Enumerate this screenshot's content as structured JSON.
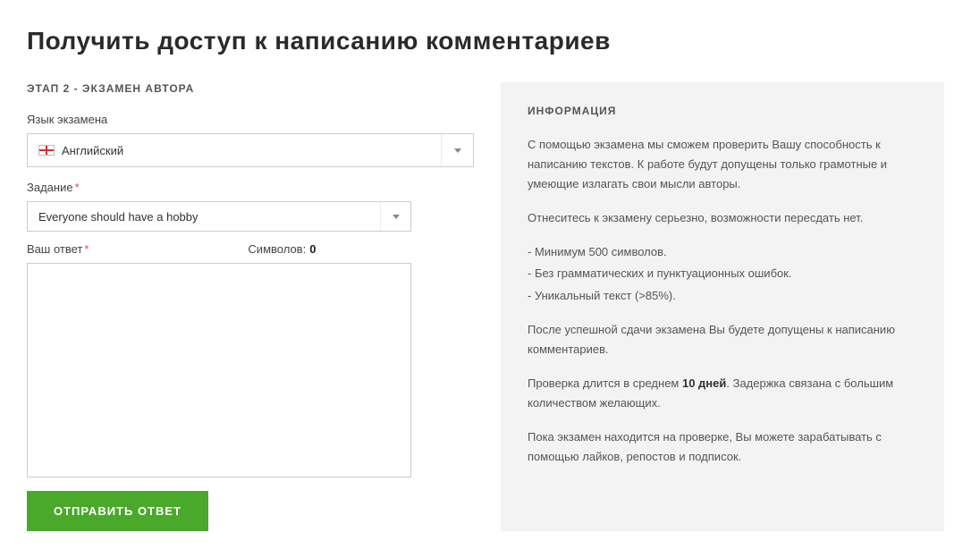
{
  "page_title": "Получить доступ к написанию комментариев",
  "left": {
    "step_label": "ЭТАП 2 - ЭКЗАМЕН АВТОРА",
    "lang_label": "Язык экзамена",
    "lang_value": "Английский",
    "task_label": "Задание",
    "task_value": "Everyone should have a hobby",
    "answer_label": "Ваш ответ",
    "symbols_label": "Символов:",
    "symbols_count": "0",
    "submit_label": "ОТПРАВИТЬ ОТВЕТ"
  },
  "info": {
    "title": "ИНФОРМАЦИЯ",
    "p1": "С помощью экзамена мы сможем проверить Вашу способность к написанию текстов. К работе будут допущены только грамотные и умеющие излагать свои мысли авторы.",
    "p2": "Отнеситесь к экзамену серьезно, возможности пересдать нет.",
    "rule1": "- Минимум 500 символов.",
    "rule2": "- Без грамматических и пунктуационных ошибок.",
    "rule3": "- Уникальный текст (>85%).",
    "p3a": "После успешной сдачи экзамена Вы будете допущены к написанию комментариев.",
    "p3b_pre": "Проверка длится в среднем ",
    "p3b_bold": "10 дней",
    "p3b_post": ". Задержка связана с большим количеством желающих.",
    "p4": "Пока экзамен находится на проверке, Вы можете зарабатывать с помощью лайков, репостов и подписок."
  }
}
